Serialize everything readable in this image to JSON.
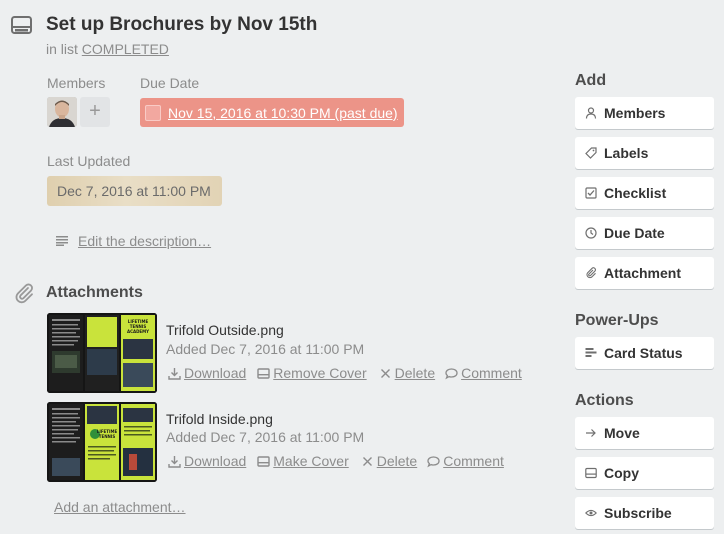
{
  "card": {
    "title": "Set up Brochures by Nov 15th",
    "in_list_prefix": "in list",
    "list_name": "COMPLETED"
  },
  "members": {
    "label": "Members",
    "add_symbol": "+"
  },
  "due_date": {
    "label": "Due Date",
    "value": "Nov 15, 2016 at 10:30 PM (past due)",
    "badge_color": "#ec9488"
  },
  "last_updated": {
    "label": "Last Updated",
    "value": "Dec 7, 2016 at 11:00 PM"
  },
  "description": {
    "link": "Edit the description…"
  },
  "attachments": {
    "heading": "Attachments",
    "items": [
      {
        "name": "Trifold Outside.png",
        "added": "Added Dec 7, 2016 at 11:00 PM",
        "download": "Download",
        "cover": "Remove Cover",
        "delete": "Delete",
        "comment": "Comment"
      },
      {
        "name": "Trifold Inside.png",
        "added": "Added Dec 7, 2016 at 11:00 PM",
        "download": "Download",
        "cover": "Make Cover",
        "delete": "Delete",
        "comment": "Comment"
      }
    ],
    "add_link": "Add an attachment…"
  },
  "sidebar": {
    "add": {
      "heading": "Add",
      "buttons": [
        "Members",
        "Labels",
        "Checklist",
        "Due Date",
        "Attachment"
      ],
      "icons": [
        "person-icon",
        "label-icon",
        "checklist-icon",
        "clock-icon",
        "paperclip-icon"
      ]
    },
    "powerups": {
      "heading": "Power-Ups",
      "buttons": [
        "Card Status"
      ],
      "icons": [
        "card-status-icon"
      ]
    },
    "actions": {
      "heading": "Actions",
      "buttons": [
        "Move",
        "Copy",
        "Subscribe"
      ],
      "icons": [
        "arrow-right-icon",
        "card-icon",
        "eye-icon"
      ]
    }
  },
  "thumbnail": {
    "brochure_text": [
      "LIFETIME",
      "TENNIS",
      "ACADEMY"
    ],
    "accent": "#c9e33b"
  },
  "colors": {
    "background": "#edeff0",
    "button_bg": "#ffffff",
    "muted_text": "#8c8c8c"
  }
}
